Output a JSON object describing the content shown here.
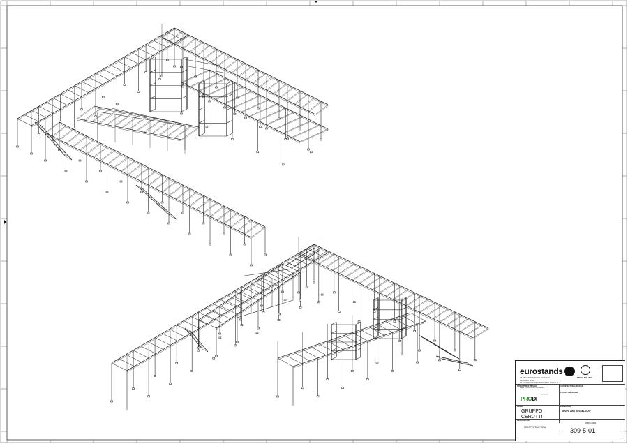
{
  "title_block": {
    "brand": "eurostands",
    "brand_lines": [
      "LA REGISTRAZIONE DI PIANO - MODELLI STD",
      "LA GESTIONE DEI PROGETTI E DELLE STRUTTURE",
      "PER LO STAND DI FIERA"
    ],
    "partner_logo": "FIERA MILANO",
    "structural_design_label": "STRUCTURAL DESIGN",
    "structural_logo": {
      "green": "PRO",
      "black": "DI"
    },
    "architectural_design_label": "ARCHITECTURAL DESIGN",
    "project_manager_label": "PROJECT MANAGER",
    "client_label": "CLIENT",
    "client": [
      "GRUPPO",
      "CERUTTI"
    ],
    "exhibition_label": "EXHIBITION",
    "exhibition": "DRUPA 2008 DUSSELDORF",
    "description_label": "DESCRIPTION",
    "description": "PERSPECTIVE VIEW",
    "date": "25.03.2008",
    "drawing_number": "309-5-01"
  },
  "colors": {
    "line": "#2a2a2a",
    "frame": "#333333",
    "green": "#2b8a2b"
  }
}
